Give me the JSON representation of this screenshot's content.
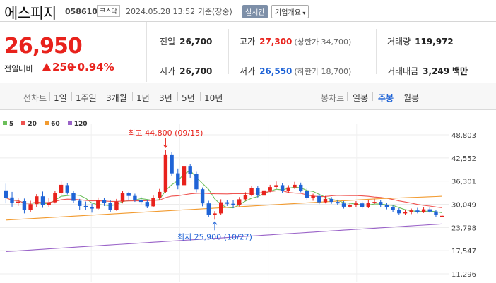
{
  "header": {
    "title": "에스피지",
    "code": "058610",
    "market": "코스닥",
    "datetime": "2024.05.28 13:52",
    "basis": "기준(장중)",
    "live_badge": "실시간",
    "info_button": "기업개요"
  },
  "quote": {
    "price": "26,950",
    "change_label": "전일대비",
    "change_value": "250",
    "change_pct": "+0.94%",
    "direction": "up",
    "up_color": "#e8221c",
    "down_color": "#1f63d6"
  },
  "stats": {
    "prev_close": {
      "label": "전일",
      "value": "26,700"
    },
    "open": {
      "label": "시가",
      "value": "26,700"
    },
    "high": {
      "label": "고가",
      "value": "27,300",
      "sub": "(상한가 34,700)"
    },
    "low": {
      "label": "저가",
      "value": "26,550",
      "sub": "(하한가 18,700)"
    },
    "volume": {
      "label": "거래량",
      "value": "119,972"
    },
    "amount": {
      "label": "거래대금",
      "value": "3,249",
      "unit": "백만"
    }
  },
  "tabs": {
    "line_label": "선차트",
    "line_periods": [
      "1일",
      "1주일",
      "3개월",
      "1년",
      "3년",
      "5년",
      "10년"
    ],
    "candle_label": "봉차트",
    "candle_periods": [
      "일봉",
      "주봉",
      "월봉"
    ],
    "candle_selected": "주봉"
  },
  "chart_data": {
    "type": "candlestick",
    "period": "weekly",
    "y_ticks": [
      "48,803",
      "42,552",
      "36,301",
      "30,049",
      "23,798",
      "17,547",
      "11,296"
    ],
    "ylim": [
      11296,
      48803
    ],
    "legend": [
      {
        "name": "5",
        "color": "#6cbf5a"
      },
      {
        "name": "20",
        "color": "#ef5350"
      },
      {
        "name": "60",
        "color": "#f29b30"
      },
      {
        "name": "120",
        "color": "#9a63c8"
      }
    ],
    "annotations": {
      "high": {
        "label": "최고 44,800 (09/15)",
        "value": 44800
      },
      "low": {
        "label": "최저 25,900 (10/27)",
        "value": 25900
      }
    },
    "candles": [
      [
        33800,
        31800,
        35600,
        30300
      ],
      [
        31900,
        30500,
        33400,
        29400
      ],
      [
        30400,
        30800,
        31700,
        29600
      ],
      [
        30900,
        28500,
        31600,
        27600
      ],
      [
        28500,
        30100,
        31000,
        27900
      ],
      [
        30100,
        32200,
        32800,
        29300
      ],
      [
        32200,
        29800,
        33500,
        29100
      ],
      [
        29800,
        30600,
        31800,
        29400
      ],
      [
        30600,
        33100,
        33700,
        30300
      ],
      [
        33100,
        35300,
        36200,
        32400
      ],
      [
        35200,
        33200,
        35800,
        32700
      ],
      [
        33200,
        31000,
        33700,
        30400
      ],
      [
        31000,
        29600,
        31500,
        28600
      ],
      [
        29600,
        29200,
        30800,
        28500
      ],
      [
        29200,
        28900,
        30200,
        27800
      ],
      [
        28900,
        31100,
        31900,
        28600
      ],
      [
        31100,
        30500,
        31700,
        29600
      ],
      [
        30500,
        28600,
        31100,
        27900
      ],
      [
        28600,
        30800,
        31500,
        28300
      ],
      [
        30800,
        33000,
        33600,
        30300
      ],
      [
        33000,
        32300,
        33400,
        31000
      ],
      [
        32300,
        31200,
        32900,
        30700
      ],
      [
        31200,
        30700,
        32100,
        30100
      ],
      [
        30700,
        29500,
        31300,
        29000
      ],
      [
        29500,
        31800,
        32400,
        29200
      ],
      [
        31800,
        33400,
        34200,
        31300
      ],
      [
        33400,
        43500,
        44800,
        33000
      ],
      [
        43500,
        38400,
        44100,
        37700
      ],
      [
        38400,
        35200,
        39700,
        34100
      ],
      [
        35200,
        40400,
        41300,
        34600
      ],
      [
        40400,
        38300,
        41000,
        37200
      ],
      [
        38300,
        34100,
        38800,
        33300
      ],
      [
        34100,
        30300,
        34600,
        29500
      ],
      [
        30300,
        27200,
        31000,
        26700
      ],
      [
        27200,
        27600,
        28200,
        25900
      ],
      [
        27600,
        30600,
        31400,
        27100
      ],
      [
        30600,
        30200,
        31100,
        29600
      ],
      [
        30200,
        29800,
        31200,
        29000
      ],
      [
        29800,
        31400,
        32000,
        29500
      ],
      [
        31400,
        32600,
        33300,
        31000
      ],
      [
        32600,
        34400,
        35100,
        32200
      ],
      [
        34400,
        32400,
        34900,
        31900
      ],
      [
        32400,
        33800,
        34500,
        32100
      ],
      [
        33800,
        34700,
        35300,
        33300
      ],
      [
        34700,
        35200,
        36200,
        34200
      ],
      [
        35200,
        33600,
        35800,
        33000
      ],
      [
        33600,
        34600,
        35200,
        33100
      ],
      [
        34600,
        35300,
        36100,
        34200
      ],
      [
        35300,
        33700,
        35900,
        33300
      ],
      [
        33700,
        31700,
        34400,
        31200
      ],
      [
        31700,
        32300,
        32900,
        31000
      ],
      [
        32300,
        30600,
        32900,
        30100
      ],
      [
        30600,
        31500,
        32300,
        30300
      ],
      [
        31500,
        30700,
        32000,
        30200
      ],
      [
        30700,
        30300,
        31300,
        29900
      ],
      [
        30300,
        29400,
        30900,
        28900
      ],
      [
        29400,
        29800,
        30400,
        29100
      ],
      [
        29800,
        30300,
        30900,
        29300
      ],
      [
        30300,
        29300,
        30800,
        28900
      ],
      [
        29300,
        30500,
        31300,
        29000
      ],
      [
        30500,
        30700,
        31500,
        30100
      ],
      [
        30700,
        29800,
        31200,
        29200
      ],
      [
        29800,
        29200,
        30400,
        28700
      ],
      [
        29200,
        28500,
        29700,
        27900
      ],
      [
        28500,
        27600,
        29000,
        27100
      ],
      [
        27600,
        27900,
        28500,
        27200
      ],
      [
        27900,
        28400,
        28900,
        27400
      ],
      [
        28400,
        28000,
        29100,
        27600
      ],
      [
        28000,
        28700,
        29300,
        27700
      ],
      [
        28700,
        28100,
        29300,
        27800
      ],
      [
        28100,
        27100,
        28600,
        26700
      ],
      [
        26700,
        26950,
        27300,
        26550
      ]
    ]
  }
}
